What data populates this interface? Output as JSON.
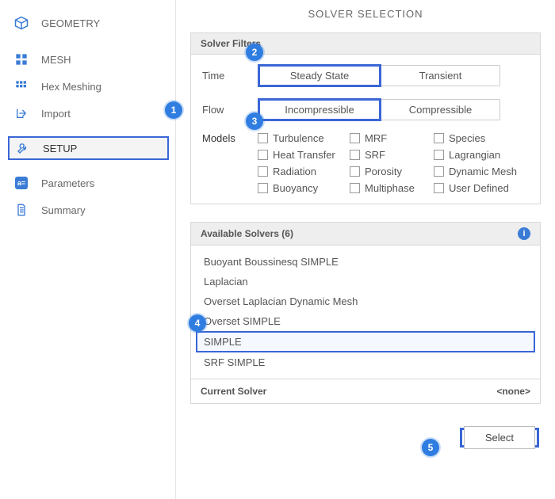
{
  "sidebar": {
    "items": [
      {
        "label": "GEOMETRY"
      },
      {
        "label": "MESH"
      },
      {
        "label": "Hex Meshing"
      },
      {
        "label": "Import"
      },
      {
        "label": "SETUP"
      },
      {
        "label": "Parameters"
      },
      {
        "label": "Summary"
      }
    ]
  },
  "main": {
    "title": "SOLVER SELECTION",
    "filters": {
      "heading": "Solver Filters",
      "time_label": "Time",
      "flow_label": "Flow",
      "models_label": "Models",
      "time_options": {
        "a": "Steady State",
        "b": "Transient"
      },
      "flow_options": {
        "a": "Incompressible",
        "b": "Compressible"
      },
      "models": [
        "Turbulence",
        "MRF",
        "Species",
        "Heat Transfer",
        "SRF",
        "Lagrangian",
        "Radiation",
        "Porosity",
        "Dynamic Mesh",
        "Buoyancy",
        "Multiphase",
        "User Defined"
      ]
    },
    "solvers": {
      "heading": "Available Solvers (6)",
      "items": [
        "Buoyant Boussinesq SIMPLE",
        "Laplacian",
        "Overset Laplacian Dynamic Mesh",
        "Overset SIMPLE",
        "SIMPLE",
        "SRF SIMPLE"
      ],
      "current_label": "Current Solver",
      "current_value": "<none>",
      "select_label": "Select"
    }
  },
  "callouts": {
    "c1": "1",
    "c2": "2",
    "c3": "3",
    "c4": "4",
    "c5": "5"
  }
}
